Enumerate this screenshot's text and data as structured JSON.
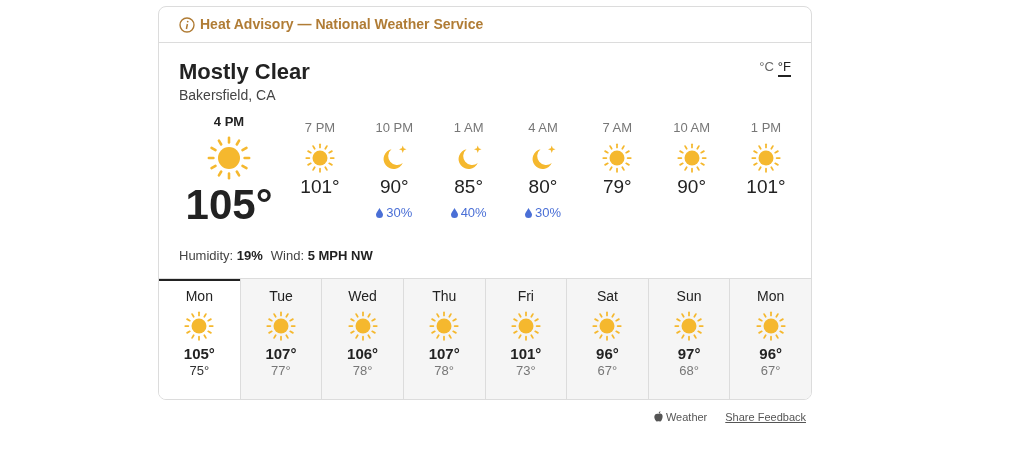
{
  "alert": {
    "text": "Heat Advisory — National Weather Service"
  },
  "current": {
    "condition": "Mostly Clear",
    "location": "Bakersfield, CA",
    "time": "4 PM",
    "temperature": "105°",
    "kind": "sun"
  },
  "units": [
    {
      "label": "°C",
      "selected": false
    },
    {
      "label": "°F",
      "selected": true
    }
  ],
  "hourly": [
    {
      "time": "7 PM",
      "kind": "sun",
      "temperature": "101°"
    },
    {
      "time": "10 PM",
      "kind": "moon",
      "temperature": "90°",
      "precipitation": "30%"
    },
    {
      "time": "1 AM",
      "kind": "moon",
      "temperature": "85°",
      "precipitation": "40%"
    },
    {
      "time": "4 AM",
      "kind": "moon",
      "temperature": "80°",
      "precipitation": "30%"
    },
    {
      "time": "7 AM",
      "kind": "sun",
      "temperature": "79°"
    },
    {
      "time": "10 AM",
      "kind": "sun",
      "temperature": "90°"
    },
    {
      "time": "1 PM",
      "kind": "sun",
      "temperature": "101°"
    }
  ],
  "details": [
    "Humidity: **19%**",
    "Wind: **5 MPH NW**"
  ],
  "daily": [
    {
      "day": "Mon",
      "kind": "sun",
      "high": "105°",
      "low": "75°",
      "selected": true
    },
    {
      "day": "Tue",
      "kind": "sun",
      "high": "107°",
      "low": "77°",
      "selected": false
    },
    {
      "day": "Wed",
      "kind": "sun",
      "high": "106°",
      "low": "78°",
      "selected": false
    },
    {
      "day": "Thu",
      "kind": "sun",
      "high": "107°",
      "low": "78°",
      "selected": false
    },
    {
      "day": "Fri",
      "kind": "sun",
      "high": "101°",
      "low": "73°",
      "selected": false
    },
    {
      "day": "Sat",
      "kind": "sun",
      "high": "96°",
      "low": "67°",
      "selected": false
    },
    {
      "day": "Sun",
      "kind": "sun",
      "high": "97°",
      "low": "68°",
      "selected": false
    },
    {
      "day": "Mon",
      "kind": "sun",
      "high": "96°",
      "low": "67°",
      "selected": false
    }
  ],
  "footer": {
    "source": "Weather",
    "link": "Share Feedback"
  }
}
